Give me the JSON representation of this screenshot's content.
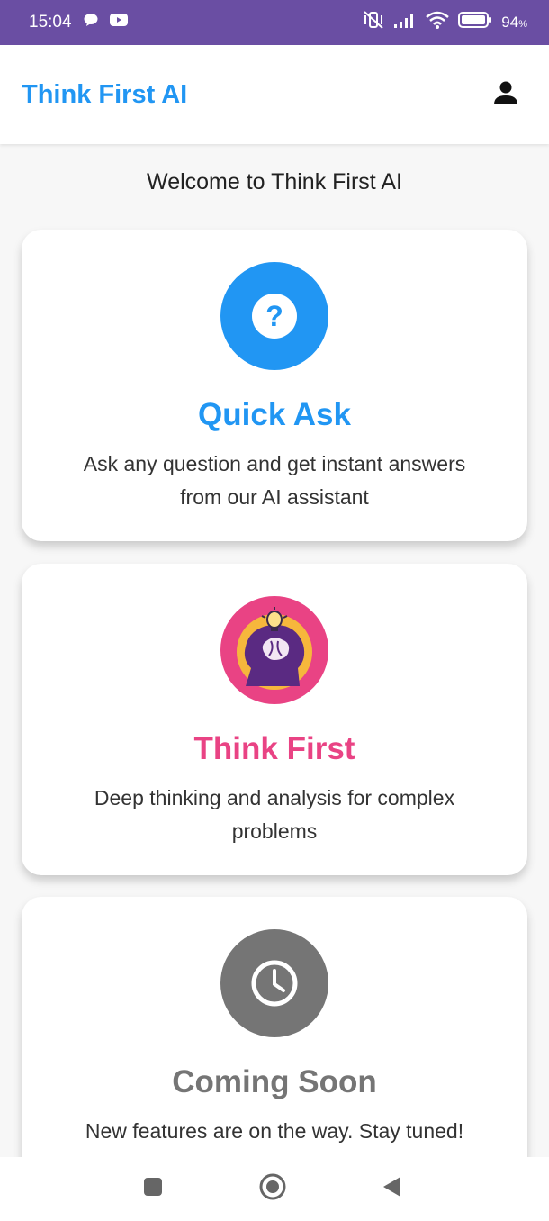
{
  "status_bar": {
    "time": "15:04",
    "battery_percent": "94",
    "battery_unit": "%",
    "icons": [
      "chat-bubble-icon",
      "youtube-icon",
      "mute-vibrate-icon",
      "signal-icon",
      "wifi-icon",
      "battery-icon"
    ]
  },
  "app_bar": {
    "title": "Think First AI",
    "title_color": "#2196f3",
    "profile_icon": "person-icon"
  },
  "main": {
    "welcome": "Welcome to Think First AI",
    "cards": [
      {
        "title": "Quick Ask",
        "description": "Ask any question and get instant answers from our AI assistant",
        "icon": "help-circle-icon",
        "color": "#2196f3"
      },
      {
        "title": "Think First",
        "description": "Deep thinking and analysis for complex problems",
        "icon": "thinking-head-icon",
        "color": "#e94384"
      },
      {
        "title": "Coming Soon",
        "description": "New features are on the way. Stay tuned!",
        "icon": "clock-icon",
        "color": "#757575"
      }
    ]
  },
  "nav_bar": {
    "buttons": [
      "recents-square-icon",
      "home-circle-icon",
      "back-triangle-icon"
    ]
  },
  "colors": {
    "status_bar": "#6a4ea3",
    "background": "#f7f7f7"
  }
}
